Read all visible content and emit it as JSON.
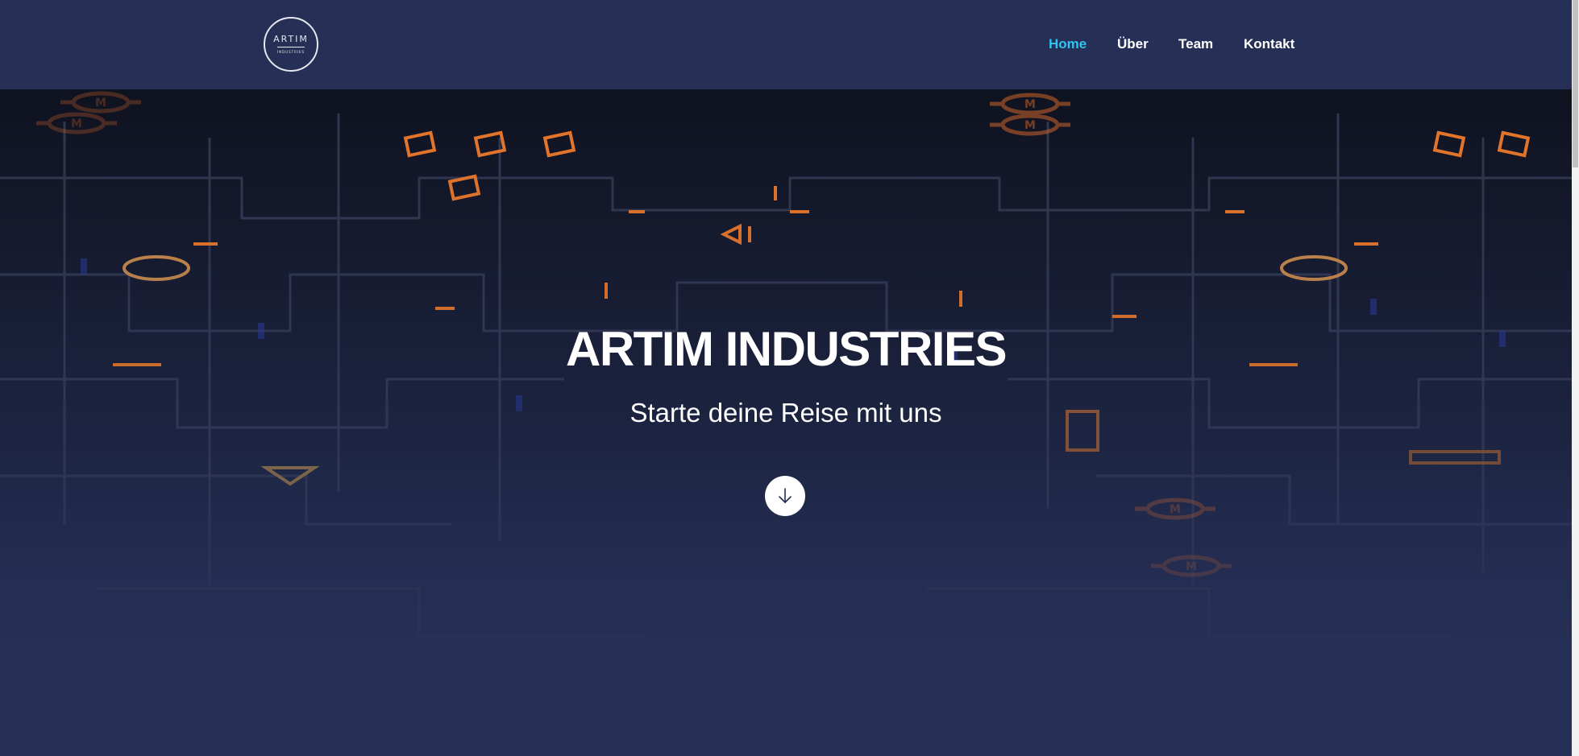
{
  "logo": {
    "main": "ARTIM",
    "sub": "INDUSTRIES"
  },
  "nav": {
    "items": [
      {
        "label": "Home",
        "active": true
      },
      {
        "label": "Über",
        "active": false
      },
      {
        "label": "Team",
        "active": false
      },
      {
        "label": "Kontakt",
        "active": false
      }
    ]
  },
  "hero": {
    "title": "ARTIM INDUSTRIES",
    "subtitle": "Starte deine Reise mit uns",
    "scroll_icon": "arrow-down-icon",
    "motor_symbol_label": "M"
  },
  "colors": {
    "header_bg": "#262f55",
    "nav_active": "#2fc3ee",
    "nav_text": "#ffffff",
    "hero_circuit_orange": "#e8772a",
    "hero_circuit_blue": "#2a3a9a"
  }
}
